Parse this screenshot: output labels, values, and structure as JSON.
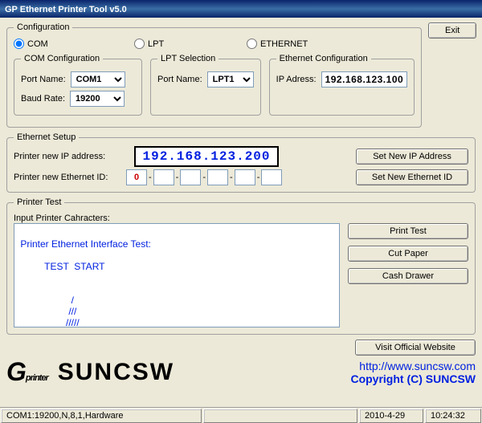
{
  "title": "GP Ethernet Printer Tool v5.0",
  "exit": "Exit",
  "legends": {
    "configuration": "Configuration",
    "com_config": "COM Configuration",
    "lpt_selection": "LPT Selection",
    "eth_config": "Ethernet Configuration",
    "eth_setup": "Ethernet Setup",
    "printer_test": "Printer Test"
  },
  "radio": {
    "com": "COM",
    "lpt": "LPT",
    "ethernet": "ETHERNET"
  },
  "com": {
    "port_label": "Port Name:",
    "port_value": "COM1",
    "baud_label": "Baud Rate:",
    "baud_value": "19200"
  },
  "lpt": {
    "port_label": "Port Name:",
    "port_value": "LPT1"
  },
  "eth": {
    "ip_label": "IP Adress:",
    "ip_value": "192.168.123.100"
  },
  "setup": {
    "new_ip_label": "Printer new IP address:",
    "new_ip_value": "192.168.123.200",
    "set_ip_btn": "Set New IP Address",
    "new_id_label": "Printer new Ethernet ID:",
    "id_values": [
      "0",
      "",
      "",
      "",
      "",
      ""
    ],
    "set_id_btn": "Set New Ethernet ID"
  },
  "test": {
    "input_label": "Input Printer Cahracters:",
    "textarea": "\n Printer Ethernet Interface Test:\n\n          TEST  START\n\n\n                    /\n                   ///\n                  /////",
    "print_btn": "Print Test",
    "cut_btn": "Cut Paper",
    "cash_btn": "Cash Drawer"
  },
  "footer": {
    "visit_btn": "Visit Official Website",
    "logo_printer": "printer",
    "logo_suncsw": "SUNCSW",
    "url": "http://www.suncsw.com",
    "copyright": "Copyright (C) SUNCSW"
  },
  "status": {
    "conn": "COM1:19200,N,8,1,Hardware",
    "date": "2010-4-29",
    "time": "10:24:32"
  }
}
